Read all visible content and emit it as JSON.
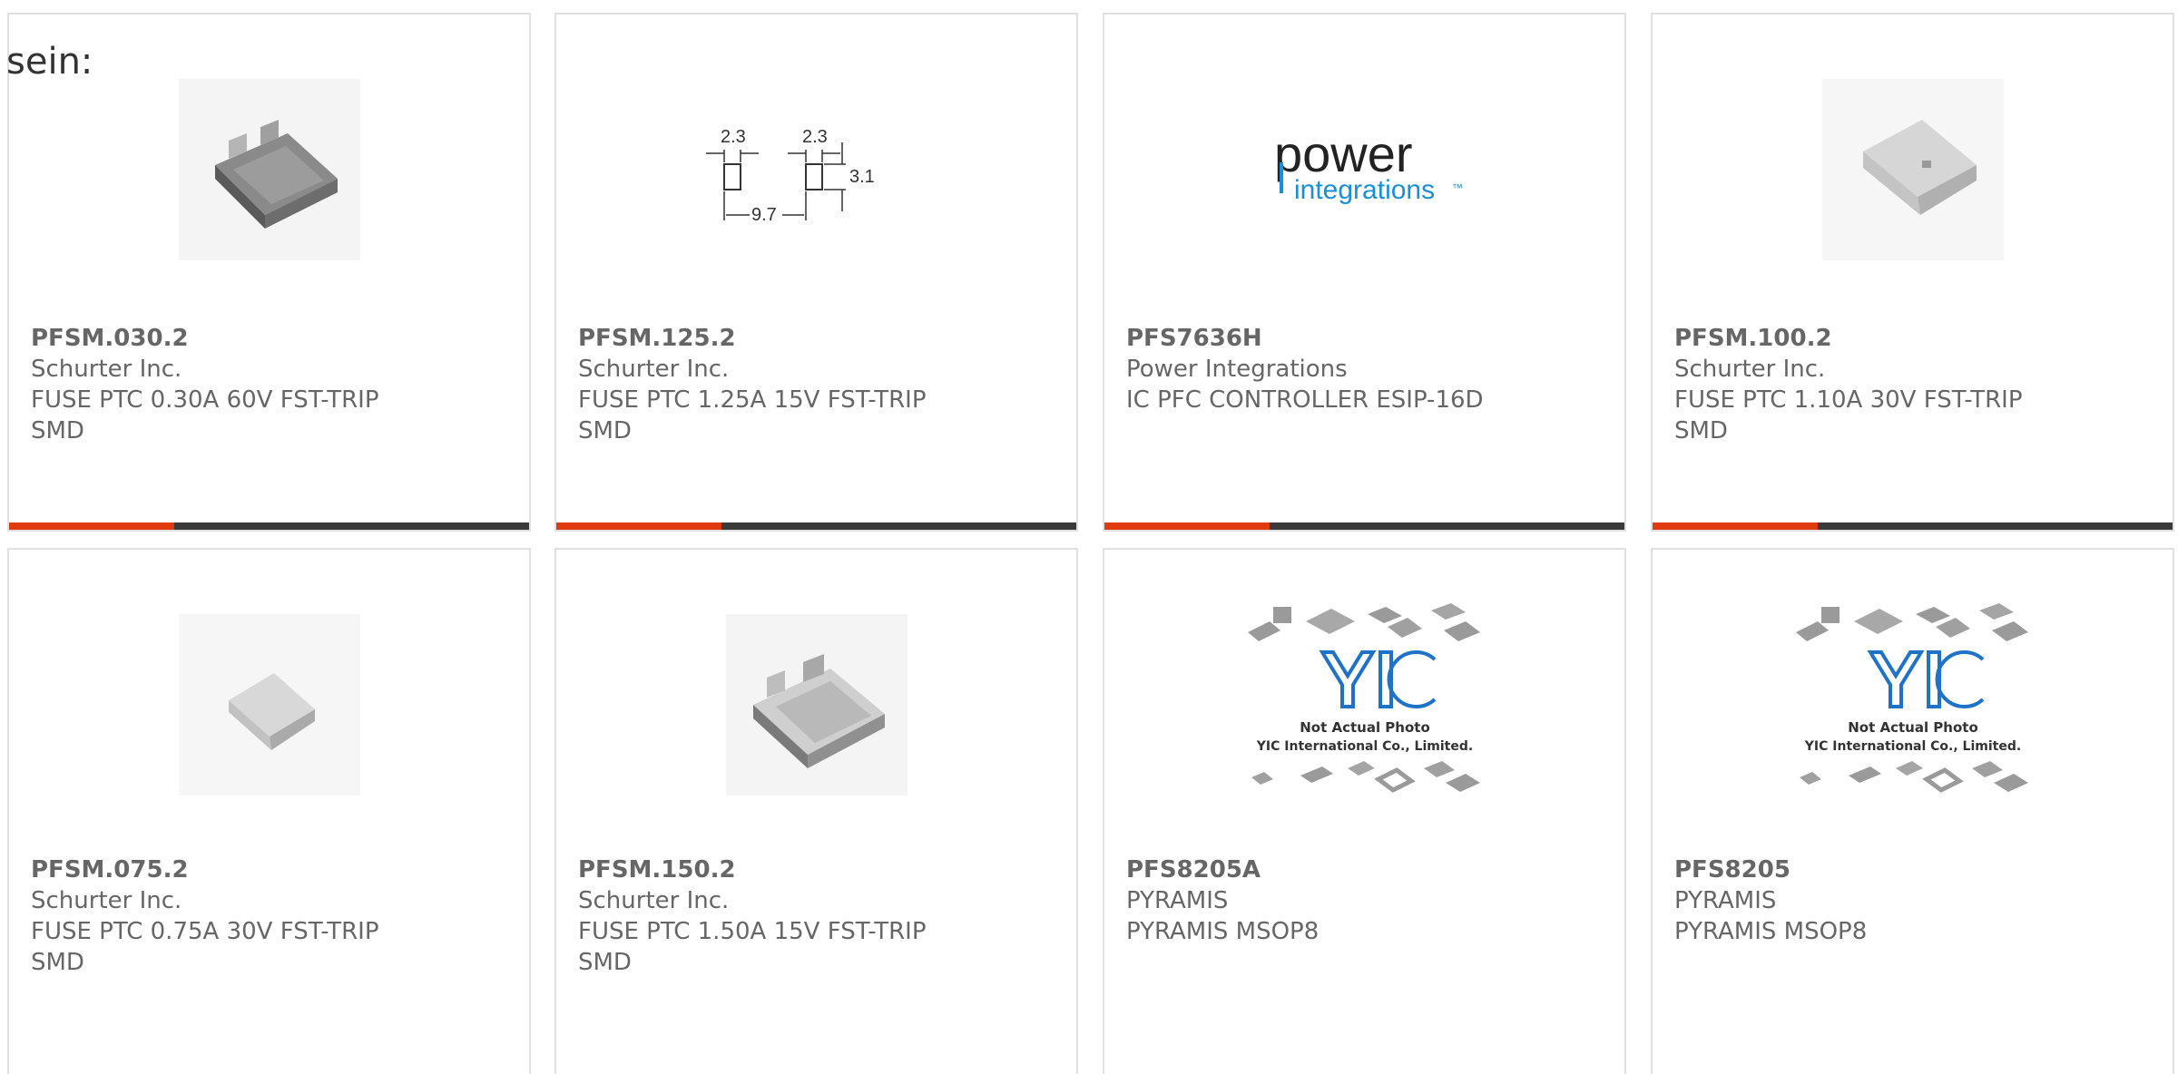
{
  "intro_text": "sein:",
  "colors": {
    "accent": "#e03a0e",
    "bar": "#3a3a3a",
    "border": "#e0e0e0",
    "text": "#666666"
  },
  "products": [
    {
      "part_number": "PFSM.030.2",
      "manufacturer": "Schurter Inc.",
      "desc_line1": "FUSE PTC 0.30A 60V FST-TRIP",
      "desc_line2": "SMD",
      "image": "fuse-photo"
    },
    {
      "part_number": "PFSM.125.2",
      "manufacturer": "Schurter Inc.",
      "desc_line1": "FUSE PTC 1.25A 15V FST-TRIP",
      "desc_line2": "SMD",
      "image": "footprint-drawing",
      "drawing_labels": {
        "pad_width_left": "2.3",
        "pad_width_right": "2.3",
        "pad_height": "3.1",
        "span": "9.7"
      }
    },
    {
      "part_number": "PFS7636H",
      "manufacturer": "Power Integrations",
      "desc_line1": "IC PFC CONTROLLER ESIP-16D",
      "image": "power-integrations-logo",
      "logo_text_main": "power",
      "logo_text_sub": "integrations",
      "logo_tm": "™"
    },
    {
      "part_number": "PFSM.100.2",
      "manufacturer": "Schurter Inc.",
      "desc_line1": "FUSE PTC 1.10A 30V FST-TRIP",
      "desc_line2": "SMD",
      "image": "fuse-photo-small"
    },
    {
      "part_number": "PFSM.075.2",
      "manufacturer": "Schurter Inc.",
      "desc_line1": "FUSE PTC 0.75A 30V FST-TRIP",
      "desc_line2": "SMD",
      "image": "fuse-photo-small"
    },
    {
      "part_number": "PFSM.150.2",
      "manufacturer": "Schurter Inc.",
      "desc_line1": "FUSE PTC 1.50A 15V FST-TRIP",
      "desc_line2": "SMD",
      "image": "fuse-photo"
    },
    {
      "part_number": "PFS8205A",
      "manufacturer": "PYRAMIS",
      "desc_line1": "PYRAMIS MSOP8",
      "image": "yic-placeholder",
      "placeholder_line1": "Not Actual Photo",
      "placeholder_line2": "YIC International Co., Limited."
    },
    {
      "part_number": "PFS8205",
      "manufacturer": "PYRAMIS",
      "desc_line1": "PYRAMIS MSOP8",
      "image": "yic-placeholder",
      "placeholder_line1": "Not Actual Photo",
      "placeholder_line2": "YIC International Co., Limited."
    }
  ]
}
